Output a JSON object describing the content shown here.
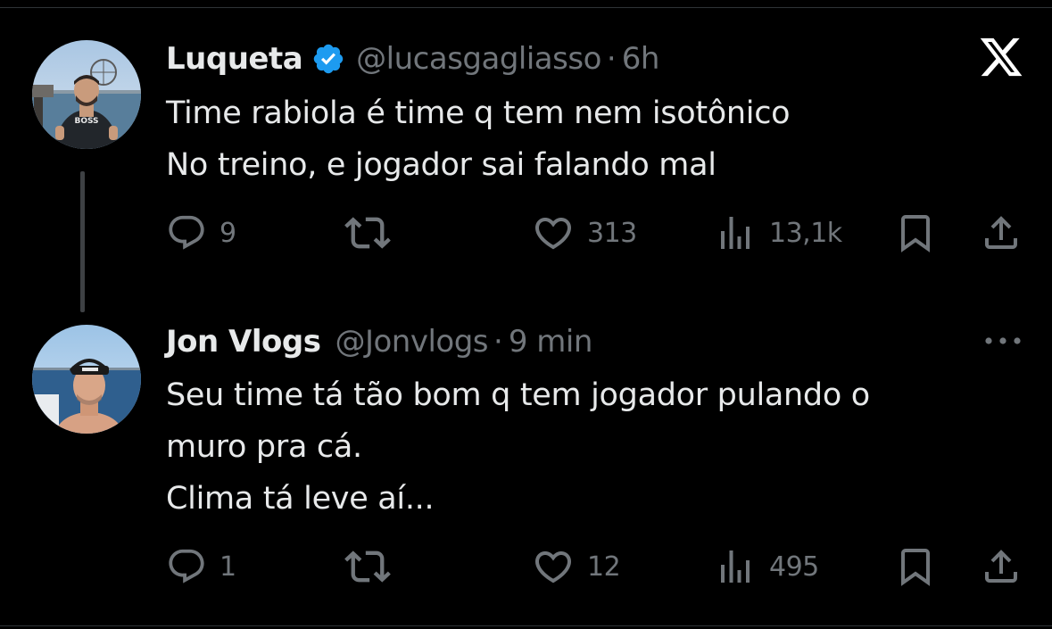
{
  "tweets": [
    {
      "name": "Luqueta",
      "verified": true,
      "handle": "@lucasgagliasso",
      "separator": "·",
      "time": "6h",
      "lines": [
        "Time rabiola é time q tem nem isotônico",
        "No treino, e jogador sai falando mal"
      ],
      "actions": {
        "replies": "9",
        "retweets": "",
        "likes": "313",
        "views": "13,1k"
      },
      "avatar_text": "BOSS"
    },
    {
      "name": "Jon Vlogs",
      "verified": false,
      "handle": "@Jonvlogs",
      "separator": "·",
      "time": "9 min",
      "lines": [
        "Seu time tá tão bom q tem jogador pulando o",
        "muro pra cá.",
        "Clima tá leve aí..."
      ],
      "actions": {
        "replies": "1",
        "retweets": "",
        "likes": "12",
        "views": "495"
      }
    }
  ],
  "icons": {
    "logo": "x-logo-icon",
    "more": "more-horizontal-icon",
    "reply": "reply-bubble-icon",
    "retweet": "retweet-icon",
    "like": "heart-icon",
    "views": "views-bars-icon",
    "bookmark": "bookmark-icon",
    "share": "share-upload-icon",
    "verified": "verified-badge-icon"
  },
  "colors": {
    "background": "#000000",
    "text": "#e7e9ea",
    "muted": "#71767b",
    "verified": "#1d9bf0",
    "divider": "#2f3336"
  }
}
